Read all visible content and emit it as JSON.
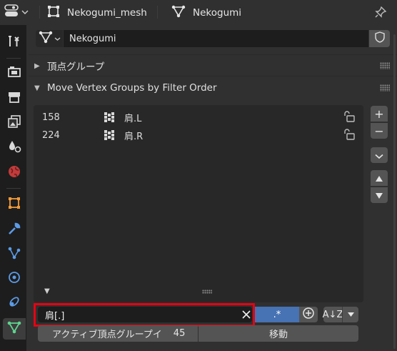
{
  "header": {
    "object_name": "Nekogumi_mesh",
    "mesh_name": "Nekogumi",
    "icons": {
      "editor_type": "properties-editor-icon",
      "object": "object-square-icon",
      "mesh": "mesh-data-icon",
      "pin": "pin-icon"
    }
  },
  "tabs": [
    {
      "name": "tool-tab",
      "icon": "tool-icon"
    },
    {
      "name": "render-tab",
      "icon": "camera-back-icon"
    },
    {
      "name": "output-tab",
      "icon": "printer-icon"
    },
    {
      "name": "view-layer-tab",
      "icon": "image-stack-icon"
    },
    {
      "name": "scene-tab",
      "icon": "scene-icon"
    },
    {
      "name": "world-tab",
      "icon": "world-icon"
    },
    {
      "name": "object-tab",
      "icon": "object-icon"
    },
    {
      "name": "modifiers-tab",
      "icon": "wrench-icon"
    },
    {
      "name": "particles-tab",
      "icon": "particles-icon"
    },
    {
      "name": "physics-tab",
      "icon": "physics-icon"
    },
    {
      "name": "constraints-tab",
      "icon": "constraint-icon"
    },
    {
      "name": "data-tab",
      "icon": "mesh-data-icon",
      "active": true
    }
  ],
  "datablock": {
    "name": "Nekogumi"
  },
  "panels": {
    "vertex_groups": {
      "title": "頂点グループ",
      "collapsed": true
    },
    "move_vertex_groups": {
      "title": "Move Vertex Groups by Filter Order",
      "collapsed": false
    }
  },
  "list": {
    "items": [
      {
        "index": "158",
        "name": "肩.L"
      },
      {
        "index": "224",
        "name": "肩.R"
      }
    ]
  },
  "side_buttons": {
    "add": "+",
    "remove": "−"
  },
  "filter": {
    "value": "肩[.]",
    "regex_label": ".*",
    "sort_label": "A↓Z"
  },
  "actions": {
    "active_label": "アクティブ頂点グループイ",
    "active_value": "45",
    "move_label": "移動"
  },
  "colors": {
    "highlight_box": "#e60012",
    "accent": "#4772b3"
  }
}
